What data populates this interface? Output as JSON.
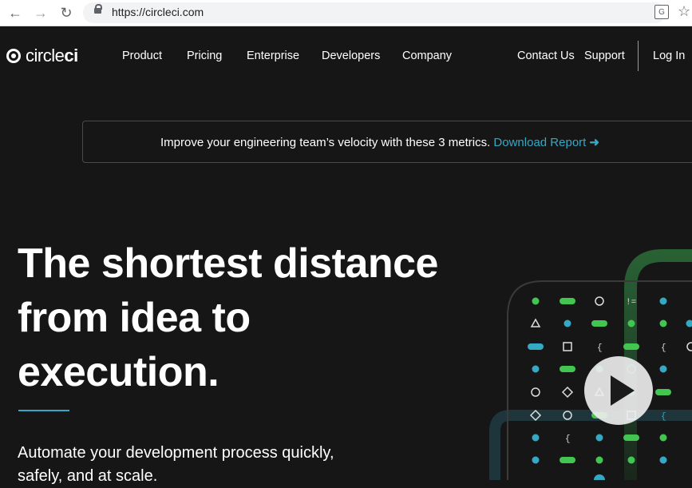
{
  "browser": {
    "url": "https://circleci.com"
  },
  "nav": {
    "logo_prefix": "circle",
    "logo_suffix": "ci",
    "links": [
      "Product",
      "Pricing",
      "Enterprise",
      "Developers",
      "Company"
    ],
    "contact": "Contact Us",
    "support": "Support",
    "login": "Log In"
  },
  "banner": {
    "text": "Improve your engineering team’s velocity with these 3 metrics.",
    "link": "Download Report"
  },
  "hero": {
    "title_lines": [
      "The shortest distance",
      "from idea to",
      "execution."
    ],
    "subtitle": "Automate your development process quickly, safely, and at scale."
  },
  "colors": {
    "background": "#161616",
    "accent": "#35a8c4",
    "green": "#42c651"
  },
  "icons": [
    "back-icon",
    "forward-icon",
    "reload-icon",
    "lock-icon",
    "translate-icon",
    "star-icon",
    "play-icon"
  ]
}
